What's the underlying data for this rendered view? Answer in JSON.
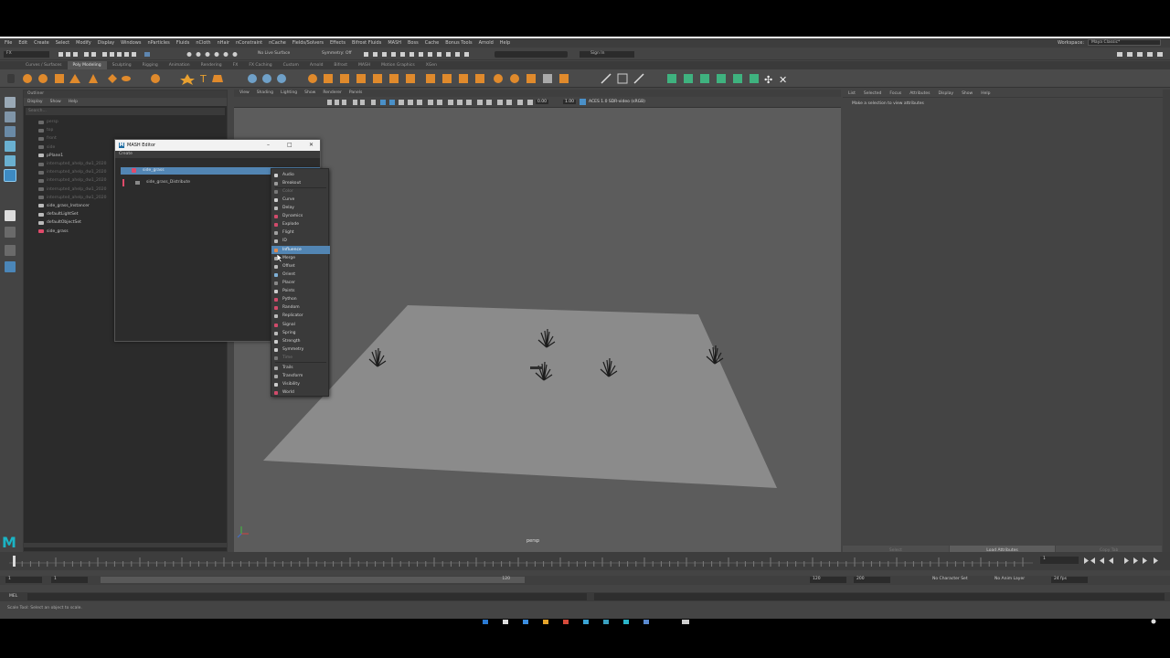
{
  "menubar": {
    "items": [
      "File",
      "Edit",
      "Create",
      "Select",
      "Modify",
      "Display",
      "Windows",
      "nParticles",
      "Fluids",
      "nCloth",
      "nHair",
      "nConstraint",
      "nCache",
      "Fields/Solvers",
      "Effects",
      "Bifrost Fluids",
      "MASH",
      "Boss",
      "Cache",
      "Bonus Tools",
      "Arnold",
      "Help"
    ],
    "workspace_label": "Workspace:",
    "workspace_value": "Maya Classic*"
  },
  "status": {
    "mode": "FX",
    "live_surface": "No Live Surface",
    "symmetry": "Symmetry: Off",
    "sign_in": "Sign In"
  },
  "shelf_tabs": [
    "Curves / Surfaces",
    "Poly Modeling",
    "Sculpting",
    "Rigging",
    "Animation",
    "Rendering",
    "FX",
    "FX Caching",
    "Custom",
    "Arnold",
    "Bifrost",
    "MASH",
    "Motion Graphics",
    "XGen"
  ],
  "shelf_active_index": 1,
  "outliner": {
    "title": "Outliner",
    "menu": [
      "Display",
      "Show",
      "Help"
    ],
    "search_placeholder": "Search...",
    "rows": [
      {
        "label": "persp",
        "dim": true
      },
      {
        "label": "top",
        "dim": true
      },
      {
        "label": "front",
        "dim": true
      },
      {
        "label": "side",
        "dim": true
      },
      {
        "label": "pPlane1",
        "dim": false
      },
      {
        "label": "interrupted_ahelp_dw1_2020",
        "dim": true
      },
      {
        "label": "interrupted_ahelp_dw1_2020",
        "dim": true
      },
      {
        "label": "interrupted_ahelp_dw1_2020",
        "dim": true
      },
      {
        "label": "interrupted_ahelp_dw1_2020",
        "dim": true
      },
      {
        "label": "interrupted_ahelp_dw1_2020",
        "dim": true
      },
      {
        "label": "side_grass_Instancer",
        "dim": false
      },
      {
        "label": "defaultLightSet",
        "dim": false
      },
      {
        "label": "defaultObjectSet",
        "dim": false
      },
      {
        "label": "side_grass",
        "dim": false
      }
    ]
  },
  "viewport": {
    "menu": [
      "View",
      "Shading",
      "Lighting",
      "Show",
      "Renderer",
      "Panels"
    ],
    "camera_label": "persp",
    "field_a": "0.00",
    "field_b": "1.00",
    "color_space": "ACES 1.0 SDR-video (sRGB)"
  },
  "attribute_editor": {
    "menu": [
      "List",
      "Selected",
      "Focus",
      "Attributes",
      "Display",
      "Show",
      "Help"
    ],
    "message": "Make a selection to view attributes",
    "buttons": [
      "Select",
      "Load Attributes",
      "Copy Tab"
    ]
  },
  "mash_editor": {
    "title": "MASH Editor",
    "menu": "Create",
    "network": "side_grass",
    "distribute": "side_grass_Distribute",
    "dropdown": [
      {
        "label": "Audio",
        "color": "#d0d0d0"
      },
      {
        "label": "Breakout",
        "color": "#9a9a9a"
      },
      {
        "label": "Color",
        "color": "#777777"
      },
      {
        "label": "Curve",
        "color": "#cfcfcf"
      },
      {
        "label": "Delay",
        "color": "#bbbbbb"
      },
      {
        "label": "Dynamics",
        "color": "#d14b6b"
      },
      {
        "label": "Explode",
        "color": "#d14b6b"
      },
      {
        "label": "Flight",
        "color": "#a0a0a0"
      },
      {
        "label": "ID",
        "color": "#bbbbbb"
      },
      {
        "label": "Influence",
        "color": "#e08a50"
      },
      {
        "label": "Merge",
        "color": "#aaaaaa"
      },
      {
        "label": "Offset",
        "color": "#bbbbbb"
      },
      {
        "label": "Orient",
        "color": "#7fb0d6"
      },
      {
        "label": "Placer",
        "color": "#888888"
      },
      {
        "label": "Points",
        "color": "#cccccc"
      },
      {
        "label": "Python",
        "color": "#d14b6b"
      },
      {
        "label": "Random",
        "color": "#d14b6b"
      },
      {
        "label": "Replicator",
        "color": "#bbbbbb"
      },
      {
        "label": "Signal",
        "color": "#d14b6b"
      },
      {
        "label": "Spring",
        "color": "#bbbbbb"
      },
      {
        "label": "Strength",
        "color": "#cccccc"
      },
      {
        "label": "Symmetry",
        "color": "#cccccc"
      },
      {
        "label": "Time",
        "color": "#777777"
      },
      {
        "label": "Trails",
        "color": "#aaaaaa"
      },
      {
        "label": "Transform",
        "color": "#aaaaaa"
      },
      {
        "label": "Visibility",
        "color": "#cccccc"
      },
      {
        "label": "World",
        "color": "#d14b6b"
      }
    ],
    "selected_item": "Influence"
  },
  "timeline": {
    "start": "1",
    "end": "120",
    "range_start": "1",
    "range_end": "120",
    "anim_end": "200",
    "current": "1",
    "character_set": "No Character Set",
    "anim_layer": "No Anim Layer",
    "fps": "24 fps"
  },
  "cmd": {
    "lang": "MEL"
  },
  "helpline": {
    "text": "Scale Tool: Select an object to scale."
  },
  "colors": {
    "accent": "#5285b3",
    "viewport_bg": "#5c5c5c",
    "plane": "#8a8a8a",
    "mash_pink": "#e04a6a"
  }
}
